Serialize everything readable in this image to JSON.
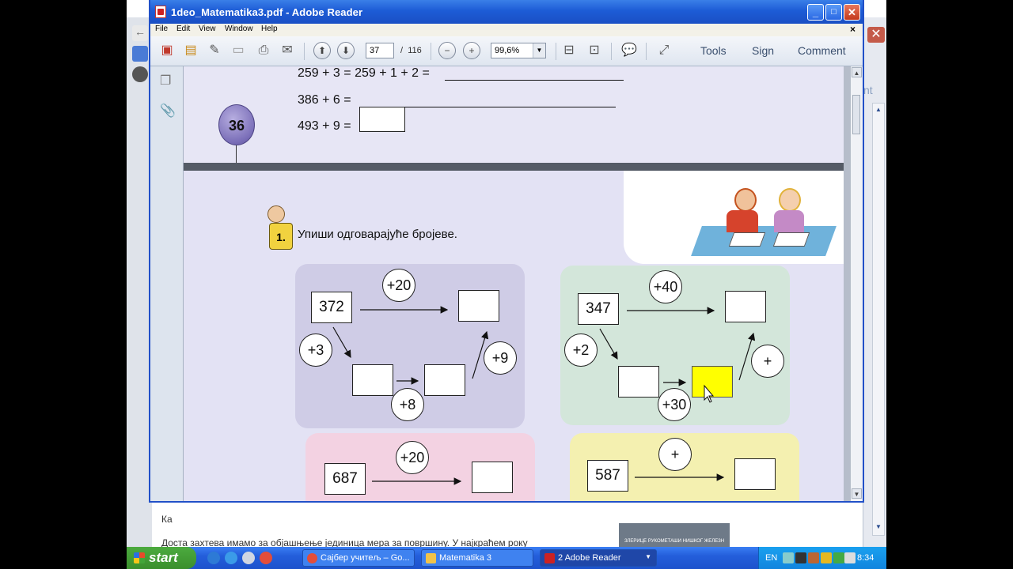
{
  "window": {
    "title": "1deo_Matematika3.pdf - Adobe Reader",
    "controls": {
      "minimize": "_",
      "maximize": "□",
      "close": "✕"
    }
  },
  "menu": {
    "items": [
      "File",
      "Edit",
      "View",
      "Window",
      "Help"
    ],
    "close": "×"
  },
  "toolbar": {
    "page_current": "37",
    "page_separator": "/",
    "page_total": "116",
    "zoom": "99,6%",
    "tools_label": "Tools",
    "sign_label": "Sign",
    "comment_label": "Comment"
  },
  "document": {
    "page_top": {
      "equation1": "259 + 3 = 259 + 1 + 2 =",
      "equation2": "386 + 6 =",
      "equation3": "493 + 9 =",
      "page_number": "36"
    },
    "page_main": {
      "task_number": "1.",
      "task_text": "Упиши одговарајуће бројеве.",
      "panels": [
        {
          "start": "372",
          "top_op": "+20",
          "left_op": "+3",
          "bottom_op": "+8",
          "right_op": "+9"
        },
        {
          "start": "347",
          "top_op": "+40",
          "left_op": "+2",
          "bottom_op": "+30",
          "right_op": "+"
        },
        {
          "start": "687",
          "top_op": "+20"
        },
        {
          "start": "587",
          "top_op": "+"
        }
      ]
    }
  },
  "background_browser": {
    "right_fragment": "nt",
    "bottom_text_1": "Ка",
    "bottom_text_2": "Доста захтева имамо за објашњење јединица мера за површину. У најкраћем року",
    "thumb_caption": "ЗЛЕРИЦЕ РУКОМЕТАШИ НИШКОГ ЖЕЛЕЗН"
  },
  "taskbar": {
    "start_label": "start",
    "tasks": [
      "Сајбер учитељ – Go...",
      "Matematika 3",
      "2 Adobe Reader"
    ],
    "lang": "EN",
    "clock": "8:34"
  },
  "colors": {
    "titlebar": "#1d5cd6",
    "panel_purple": "#cfcce6",
    "panel_green": "#d3e6da",
    "panel_pink": "#f3d2e2",
    "panel_yellow": "#f4f0b0",
    "highlight_yellow": "#ffff00"
  }
}
